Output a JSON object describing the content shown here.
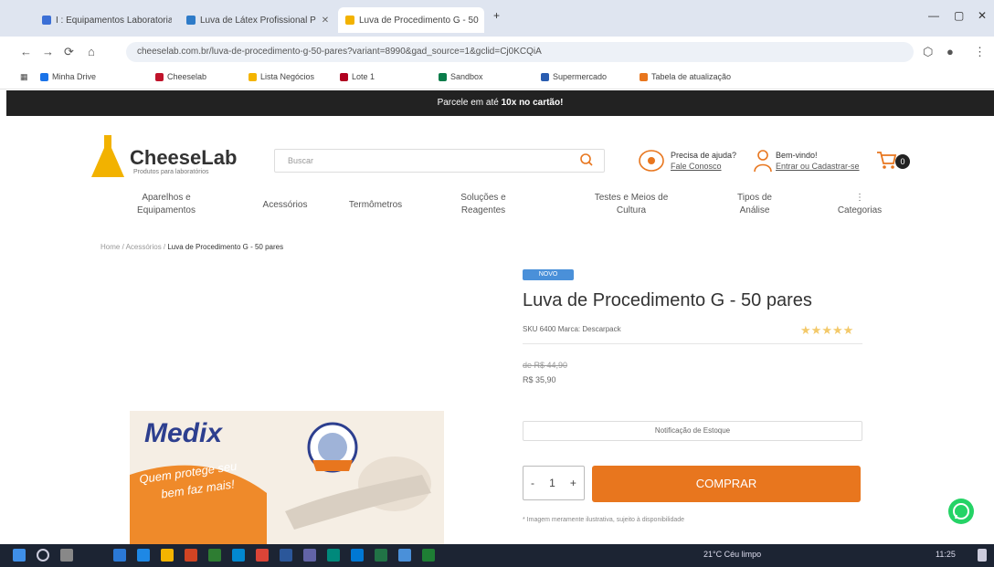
{
  "browser": {
    "tabs": [
      {
        "label": "I : Equipamentos Laboratoriais"
      },
      {
        "label": "Luva de Látex Profissional P"
      },
      {
        "label": "Luva de Procedimento G - 50"
      }
    ],
    "tab_close": "✕",
    "new_tab": "+",
    "window_controls": [
      "—",
      "▢",
      "✕"
    ],
    "address": "cheeselab.com.br/luva-de-procedimento-g-50-pares?variant=8990&gad_source=1&gclid=Cj0KCQiA",
    "bookmarks": [
      "Minha Drive",
      "Cheeselab",
      "Lista Negócios",
      "Lote 1",
      "Sandbox",
      "Supermercado",
      "Tabela de atualização"
    ]
  },
  "promo": {
    "text": "Parcele em até",
    "bold": "10x no cartão!"
  },
  "header": {
    "logo_name": "CheeseLab",
    "logo_tag": "Produtos para laboratórios",
    "search_placeholder": "Buscar",
    "help_title": "Precisa de ajuda?",
    "help_link": "Fale Conosco",
    "account_title": "Bem-vindo!",
    "account_link": "Entrar ou Cadastrar-se",
    "cart_count": "0"
  },
  "menu": [
    {
      "line1": "Aparelhos e",
      "line2": "Equipamentos"
    },
    {
      "line1": "Acessórios",
      "line2": ""
    },
    {
      "line1": "Termômetros",
      "line2": ""
    },
    {
      "line1": "Soluções e",
      "line2": "Reagentes"
    },
    {
      "line1": "Testes e Meios de",
      "line2": "Cultura"
    },
    {
      "line1": "Tipos de",
      "line2": "Análise"
    },
    {
      "line1": "Categorias",
      "line2": ""
    }
  ],
  "breadcrumb": {
    "trail": "Home / Acessórios / ",
    "current": "Luva de Procedimento G - 50 pares"
  },
  "product": {
    "badge": "NOVO",
    "title": "Luva de Procedimento G - 50 pares",
    "sku": "SKU 6400 Marca: Descarpack",
    "price_old": "de R$ 44,90",
    "price_new": "R$ 35,90",
    "notify": "Notificação de Estoque",
    "qty_minus": "-",
    "qty": "1",
    "qty_plus": "+",
    "buy_label": "COMPRAR",
    "note": "* Imagem meramente ilustrativa, sujeito à disponibilidade"
  },
  "product_image": {
    "brand": "Medix",
    "slogan_1": "Quem protege seu",
    "slogan_2": "bem faz mais!"
  },
  "taskbar": {
    "tray_text": "21°C Céu limpo",
    "clock": "11:25"
  },
  "colors": {
    "accent": "#e8761e",
    "dark": "#222222",
    "logo_flask": "#f2b200",
    "badge": "#4a90d9",
    "whatsapp": "#25d366"
  }
}
